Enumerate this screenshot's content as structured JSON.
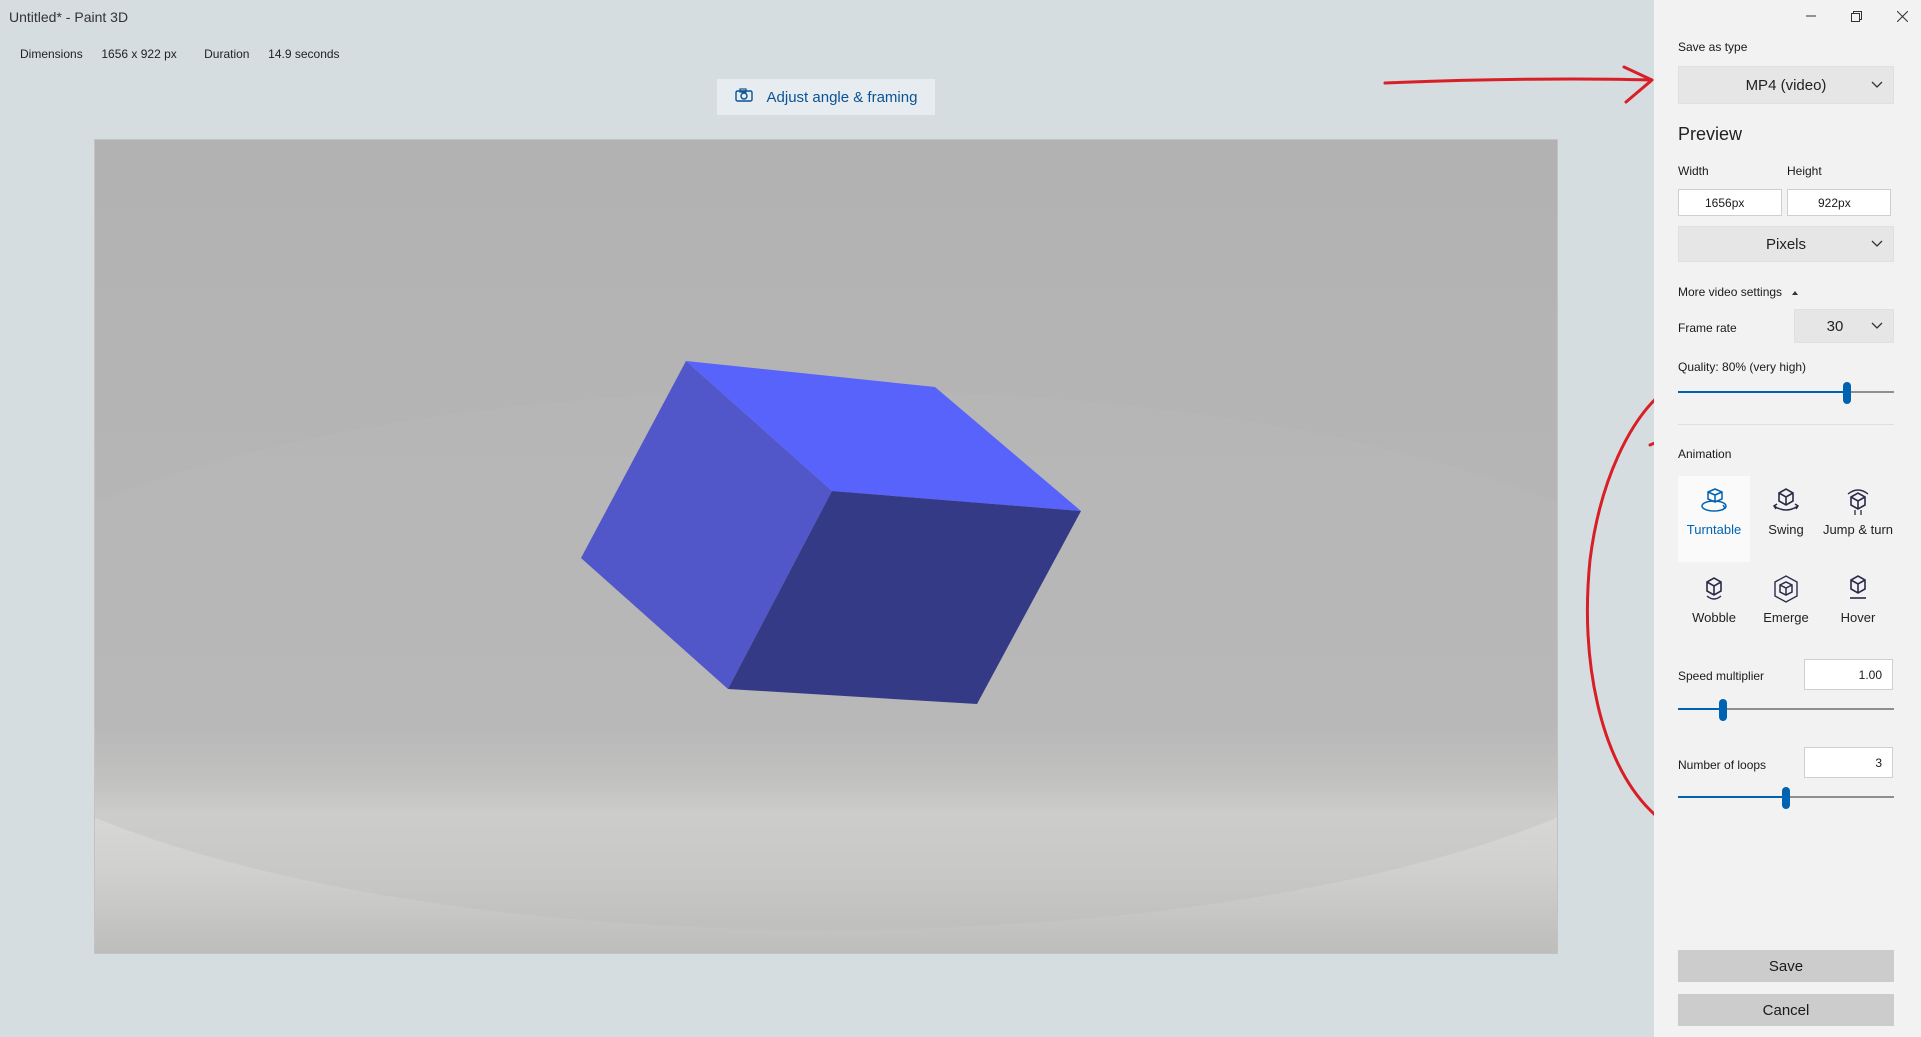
{
  "window": {
    "title": "Untitled* - Paint 3D"
  },
  "info": {
    "dimensions_label": "Dimensions",
    "dimensions_value": "1656 x 922 px",
    "duration_label": "Duration",
    "duration_value": "14.9 seconds"
  },
  "toolbar": {
    "adjust_label": "Adjust angle & framing"
  },
  "panel": {
    "save_as_type_label": "Save as type",
    "save_as_type_value": "MP4 (video)",
    "preview_heading": "Preview",
    "width_label": "Width",
    "height_label": "Height",
    "width_value": "1656px",
    "height_value": "922px",
    "units_value": "Pixels",
    "more_settings_label": "More video settings",
    "frame_rate_label": "Frame rate",
    "frame_rate_value": "30",
    "quality_label": "Quality: 80% (very high)",
    "quality_level": 0.8,
    "animation_label": "Animation",
    "animations": [
      {
        "label": "Turntable",
        "icon": "turntable-icon",
        "selected": true
      },
      {
        "label": "Swing",
        "icon": "swing-icon",
        "selected": false
      },
      {
        "label": "Jump & turn",
        "icon": "jump-turn-icon",
        "selected": false
      },
      {
        "label": "Wobble",
        "icon": "wobble-icon",
        "selected": false
      },
      {
        "label": "Emerge",
        "icon": "emerge-icon",
        "selected": false
      },
      {
        "label": "Hover",
        "icon": "hover-icon",
        "selected": false
      }
    ],
    "speed_label": "Speed multiplier",
    "speed_value": "1.00",
    "speed_level": 0.21,
    "loops_label": "Number of loops",
    "loops_value": "3",
    "loops_level": 0.5,
    "save_label": "Save",
    "cancel_label": "Cancel"
  },
  "colors": {
    "accent": "#0063b1",
    "annotation": "#d81f26",
    "cube_top": "#5863fb",
    "cube_left": "#5156c8",
    "cube_right": "#353a86"
  }
}
